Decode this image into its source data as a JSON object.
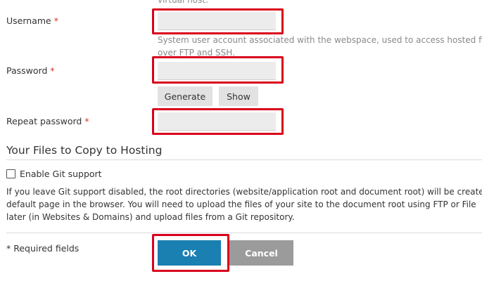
{
  "form": {
    "top_hint": "virtual host.",
    "username": {
      "label": "Username",
      "required_mark": "*",
      "value": "",
      "hint_line1": "System user account associated with the webspace, used to access hosted fi",
      "hint_line2": "over FTP and SSH."
    },
    "password": {
      "label": "Password",
      "required_mark": "*",
      "value": "",
      "generate_label": "Generate",
      "show_label": "Show"
    },
    "repeat_password": {
      "label": "Repeat password",
      "required_mark": "*",
      "value": ""
    }
  },
  "files_section": {
    "title": "Your Files to Copy to Hosting",
    "git_checkbox_label": "Enable Git support",
    "git_checked": false,
    "info_lines": [
      "If you leave Git support disabled, the root directories (website/application root and document root) will be create",
      "default page in the browser. You will need to upload the files of your site to the document root using FTP or File",
      "later (in Websites & Domains) and upload files from a Git repository."
    ]
  },
  "footer": {
    "required_note": "* Required fields",
    "ok_label": "OK",
    "cancel_label": "Cancel"
  },
  "colors": {
    "highlight": "#d9001b",
    "primary_button": "#1a7fb1",
    "cancel_button": "#9b9b9b",
    "required_asterisk": "#d9302b"
  }
}
